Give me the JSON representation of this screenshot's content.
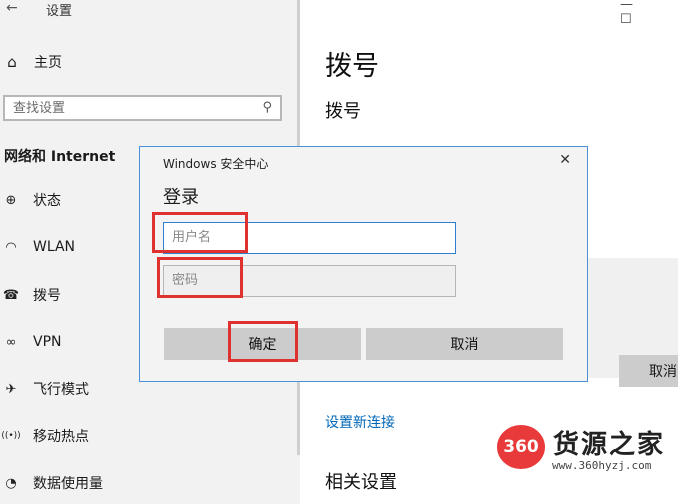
{
  "window": {
    "title": "设置",
    "back_glyph": "←",
    "controls": [
      "—",
      "☐"
    ]
  },
  "sidebar": {
    "home_label": "主页",
    "search_placeholder": "查找设置",
    "section_title": "网络和 Internet",
    "items": [
      {
        "label": "状态",
        "icon": "globe-icon",
        "glyph": "⊕"
      },
      {
        "label": "WLAN",
        "icon": "wifi-icon",
        "glyph": "◠"
      },
      {
        "label": "拨号",
        "icon": "dialup-icon",
        "glyph": "☎"
      },
      {
        "label": "VPN",
        "icon": "vpn-icon",
        "glyph": "∞"
      },
      {
        "label": "飞行模式",
        "icon": "airplane-icon",
        "glyph": "✈"
      },
      {
        "label": "移动热点",
        "icon": "hotspot-icon",
        "glyph": "((•))"
      },
      {
        "label": "数据使用量",
        "icon": "data-usage-icon",
        "glyph": "◔"
      }
    ]
  },
  "main": {
    "title": "拨号",
    "subtitle": "拨号",
    "cancel_label": "取消",
    "new_connection_link": "设置新连接",
    "related_settings": "相关设置"
  },
  "dialog": {
    "title": "Windows 安全中心",
    "heading": "登录",
    "username_placeholder": "用户名",
    "password_placeholder": "密码",
    "ok_label": "确定",
    "cancel_label": "取消"
  },
  "watermark": {
    "badge": "360",
    "name": "货源之家",
    "url": "www.360hyzj.com"
  },
  "colors": {
    "highlight": "#e03131",
    "link": "#0067b8",
    "dialog_border": "#4a90d9",
    "focus": "#2f7fd0"
  }
}
